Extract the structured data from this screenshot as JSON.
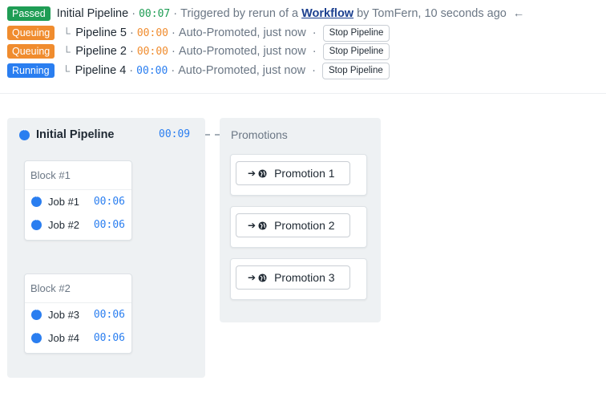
{
  "header": {
    "main": {
      "status": "Passed",
      "name": "Initial Pipeline",
      "duration": "00:07",
      "trigger_prefix": "Triggered by rerun of a",
      "workflow_link": "Workflow",
      "trigger_suffix": "by TomFern, 10 seconds ago",
      "back_arrow": "←",
      "status_color": "#1f9d55"
    },
    "promoted": [
      {
        "status": "Queuing",
        "name": "Pipeline 5",
        "duration": "00:00",
        "desc": "Auto-Promoted, just now",
        "action": "Stop Pipeline",
        "status_color": "#f08c2e"
      },
      {
        "status": "Queuing",
        "name": "Pipeline 2",
        "duration": "00:00",
        "desc": "Auto-Promoted, just now",
        "action": "Stop Pipeline",
        "status_color": "#f08c2e"
      },
      {
        "status": "Running",
        "name": "Pipeline 4",
        "duration": "00:00",
        "desc": "Auto-Promoted, just now",
        "action": "Stop Pipeline",
        "status_color": "#2a7ef0"
      }
    ],
    "separator": "·",
    "tree_glyph": "└"
  },
  "pipeline": {
    "title": "Initial Pipeline",
    "duration": "00:09",
    "icon": "running-dots-icon",
    "blocks": [
      {
        "name": "Block #1",
        "jobs": [
          {
            "name": "Job #1",
            "time": "00:06"
          },
          {
            "name": "Job #2",
            "time": "00:06"
          }
        ]
      },
      {
        "name": "Block #2",
        "jobs": [
          {
            "name": "Job #3",
            "time": "00:06"
          },
          {
            "name": "Job #4",
            "time": "00:06"
          }
        ]
      }
    ]
  },
  "promotions": {
    "title": "Promotions",
    "items": [
      {
        "label": "Promotion 1",
        "icons": [
          "arrow-right-icon",
          "globe-icon"
        ]
      },
      {
        "label": "Promotion 2",
        "icons": [
          "arrow-right-icon",
          "globe-icon"
        ]
      },
      {
        "label": "Promotion 3",
        "icons": [
          "arrow-right-icon",
          "globe-icon"
        ]
      }
    ]
  },
  "colors": {
    "accent_blue": "#2a7ef0",
    "passed_green": "#1f9d55",
    "queuing_orange": "#f08c2e",
    "panel_bg": "#eef1f3"
  }
}
